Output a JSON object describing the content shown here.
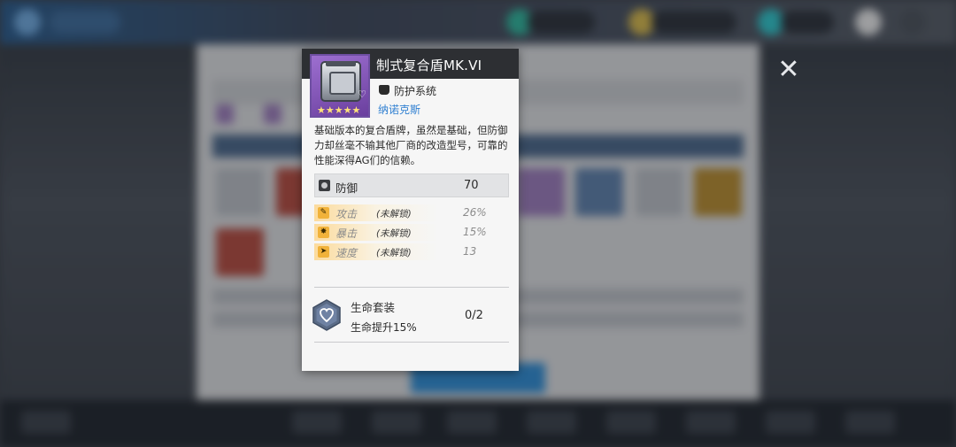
{
  "item": {
    "name": "制式复合盾MK.VI",
    "category": "防护系统",
    "category_icon": "armor-icon",
    "maker": "纳诺克斯",
    "rarity_stars": 5,
    "stars_text": "★★★★★",
    "favorite_icon": "heart-icon",
    "description": "基础版本的复合盾牌，虽然是基础，但防御力却丝毫不输其他厂商的改造型号，可靠的性能深得AG们的信赖。"
  },
  "main_stat": {
    "label": "防御",
    "value": "70",
    "icon": "defense-icon"
  },
  "sub_stats": [
    {
      "label": "攻击",
      "status": "(未解锁)",
      "value": "26%",
      "icon": "attack-icon",
      "glyph": "✎"
    },
    {
      "label": "暴击",
      "status": "(未解锁)",
      "value": "15%",
      "icon": "crit-icon",
      "glyph": "✸"
    },
    {
      "label": "速度",
      "status": "(未解锁)",
      "value": "13",
      "icon": "speed-icon",
      "glyph": "➤"
    }
  ],
  "set_bonus": {
    "label": "生命套装",
    "effect": "生命提升15%",
    "count": "0/2",
    "icon": "life-set-icon"
  },
  "colors": {
    "header_bg": "#2d2f33",
    "card_bg": "#f6f6f6",
    "rarity_purple": "#8a5cc2",
    "maker_blue": "#2f7fd1",
    "substat_gold": "#f1b23a"
  },
  "background": {
    "close_glyph": "✕"
  }
}
